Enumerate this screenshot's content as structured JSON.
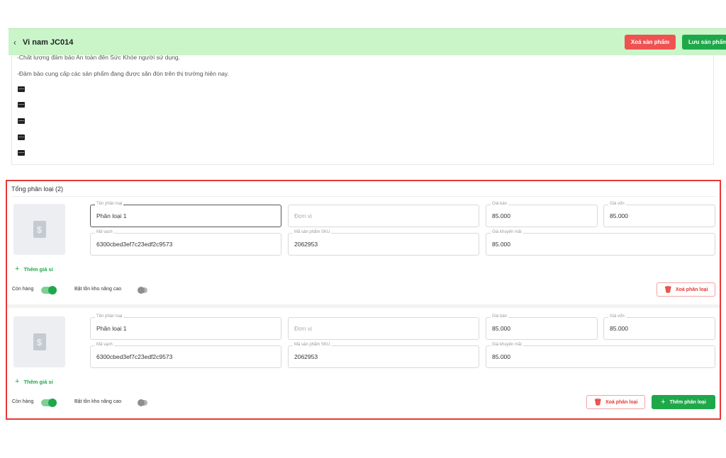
{
  "header": {
    "back_icon": "chevron-left-icon",
    "product_name": "Vi nam JC014",
    "delete_product_label": "Xoá sản phẩm",
    "save_product_label": "Lưu sản phẩm",
    "colors": {
      "bar": "#c9f5c9",
      "delete": "#f05252",
      "save": "#1fa84a"
    }
  },
  "description": {
    "lines": [
      "-Chất lượng đảm bảo An toàn đến Sức Khỏe người sử dụng.",
      "-Đảm bảo cung cấp các sản phẩm đang được săn đón trên thị trường hiện nay."
    ],
    "image_placeholder_icon": "broken-image-icon"
  },
  "variants": {
    "title": "Tổng phân loại (2)",
    "highlight_color": "#e53935",
    "items": [
      {
        "image_icon": "money-bag-icon",
        "name_label": "Tên phân loại",
        "name": "Phân loại 1",
        "unit_placeholder": "Đơn vị",
        "price_label": "Giá bán",
        "price": "85.000",
        "cost_label": "Giá vốn",
        "cost": "85.000",
        "barcode_label": "Mã vạch",
        "barcode": "6300cbed3ef7c23edf2c9573",
        "sku_label": "Mã sản phẩm SKU",
        "sku": "2062953",
        "promo_label": "Giá khuyến mãi",
        "promo_price": "85.000",
        "add_wholesale": "Thêm giá sỉ",
        "in_stock_label": "Còn hàng",
        "in_stock": true,
        "advanced_stock_label": "Bật tồn kho nâng cao",
        "advanced_stock": false,
        "delete_label": "Xoá phân loại"
      },
      {
        "image_icon": "money-bag-icon",
        "name_label": "Tên phân loại",
        "name": "Phân loại 1",
        "unit_placeholder": "Đơn vị",
        "price_label": "Giá bán",
        "price": "85.000",
        "cost_label": "Giá vốn",
        "cost": "85.000",
        "barcode_label": "Mã vạch",
        "barcode": "6300cbed3ef7c23edf2c9573",
        "sku_label": "Mã sản phẩm SKU",
        "sku": "2062953",
        "promo_label": "Giá khuyến mãi",
        "promo_price": "85.000",
        "add_wholesale": "Thêm giá sỉ",
        "in_stock_label": "Còn hàng",
        "in_stock": true,
        "advanced_stock_label": "Bật tồn kho nâng cao",
        "advanced_stock": false,
        "delete_label": "Xoá phân loại"
      }
    ],
    "add_variant_label": "Thêm phân loại"
  }
}
